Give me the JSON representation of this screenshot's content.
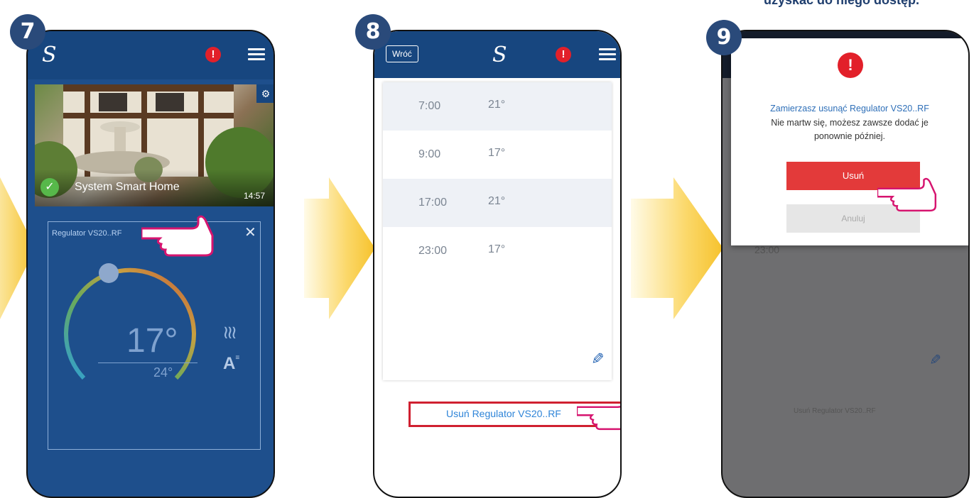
{
  "top_caption": "uzyskać do niego dostęp.",
  "steps": [
    "7",
    "8",
    "9"
  ],
  "screen7": {
    "logo": "S",
    "alert_icon": "!",
    "tile_title": "System Smart Home",
    "tile_time": "14:57",
    "widget_title": "Regulator VS20..RF",
    "current_temp": "17°",
    "set_temp": "24°",
    "heating_icon": "heat-waves-icon",
    "mode_icon": "auto-mode-icon"
  },
  "screen8": {
    "back_label": "Wróć",
    "logo": "S",
    "alert_icon": "!",
    "schedule": [
      {
        "time": "7:00",
        "temp": "21°"
      },
      {
        "time": "9:00",
        "temp": "17°"
      },
      {
        "time": "17:00",
        "temp": "21°"
      },
      {
        "time": "23:00",
        "temp": "17°"
      }
    ],
    "remove_link": "Usuń Regulator VS20..RF"
  },
  "screen9": {
    "alert_icon": "!",
    "dialog_title": "Zamierzasz usunąć Regulator VS20..RF",
    "dialog_line1": "Nie martw się, możesz zawsze dodać je",
    "dialog_line2": "ponownie później.",
    "remove_button": "Usuń",
    "cancel_button": "Anuluj",
    "bg_time": "23:00",
    "bg_remove": "Usuń Regulator VS20..RF"
  },
  "colors": {
    "app_blue": "#1e4f8c",
    "header_blue": "#17467f",
    "accent_red": "#e2202a",
    "pink_hand": "#d6146f",
    "arrow_yellow": "#f7c948"
  }
}
